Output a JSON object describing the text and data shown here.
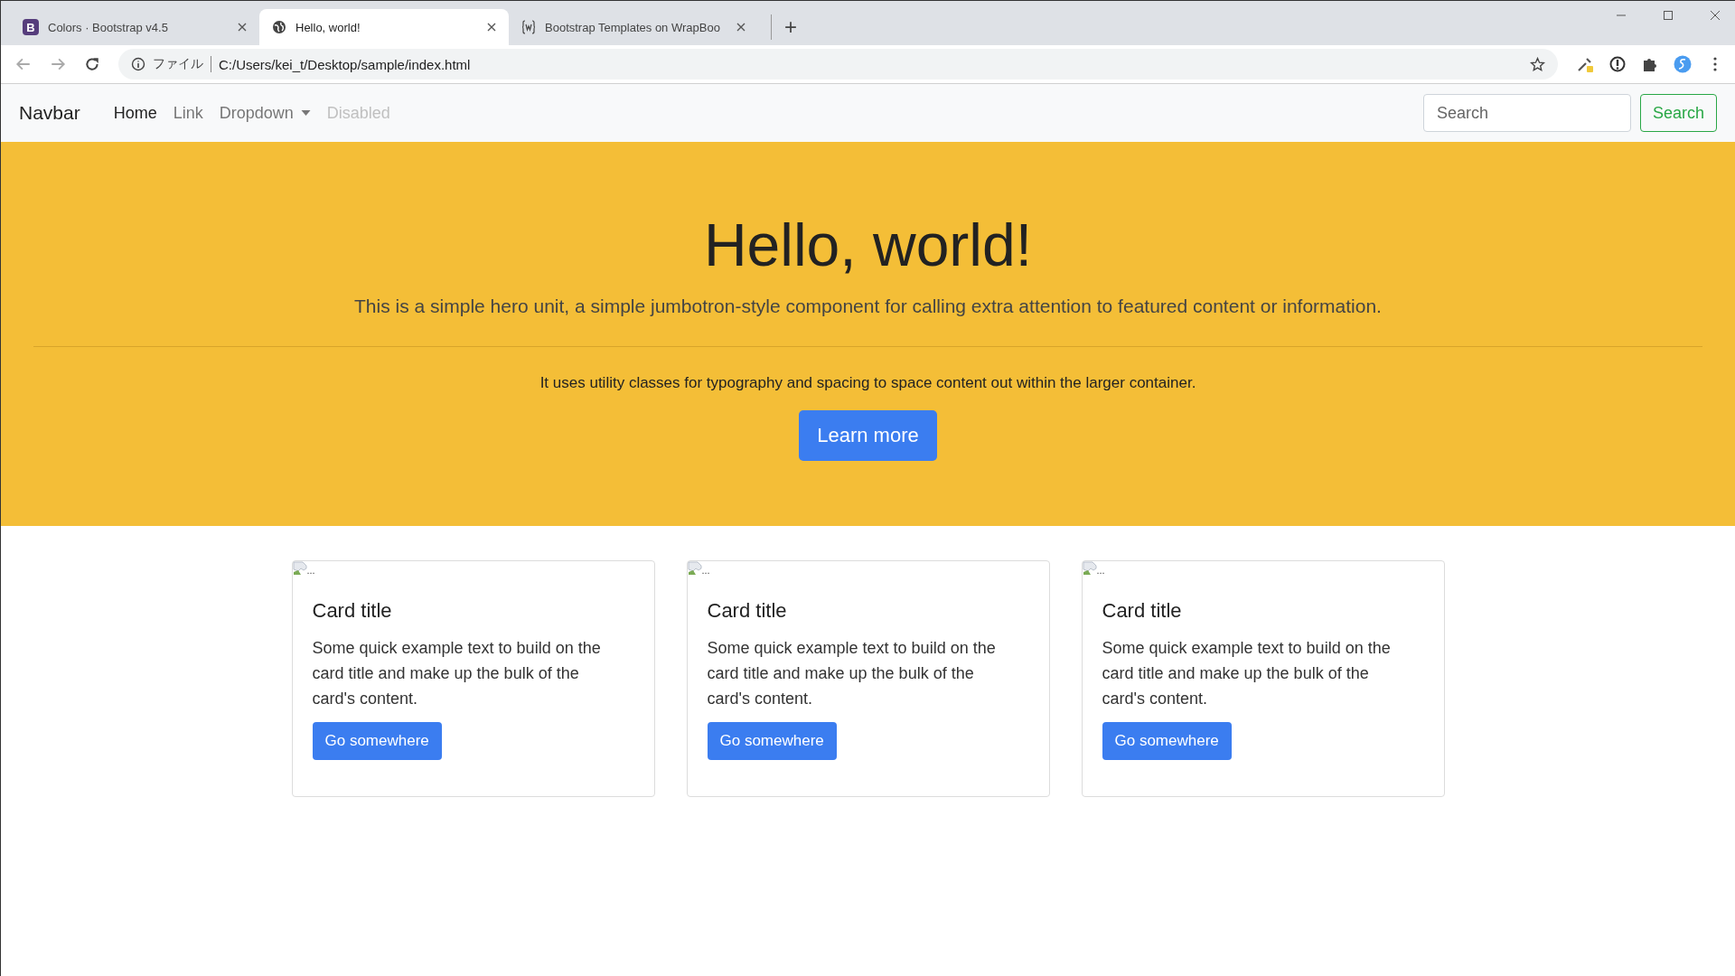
{
  "browser": {
    "tabs": [
      {
        "title": "Colors · Bootstrap v4.5",
        "kind": "letter",
        "favicon_text": "B",
        "selected": false
      },
      {
        "title": "Hello, world!",
        "kind": "globe",
        "selected": true
      },
      {
        "title": "Bootstrap Templates on WrapBoo",
        "kind": "braces",
        "selected": false
      }
    ],
    "new_tab": "+",
    "address": {
      "scheme_label": "ファイル",
      "url": "C:/Users/kei_t/Desktop/sample/index.html"
    }
  },
  "navbar": {
    "brand": "Navbar",
    "items": [
      {
        "label": "Home",
        "selected": true,
        "disabled": false,
        "dropdown": false
      },
      {
        "label": "Link",
        "selected": false,
        "disabled": false,
        "dropdown": false
      },
      {
        "label": "Dropdown",
        "selected": false,
        "disabled": false,
        "dropdown": true
      },
      {
        "label": "Disabled",
        "selected": false,
        "disabled": true,
        "dropdown": false
      }
    ],
    "search": {
      "placeholder": "Search",
      "button": "Search"
    }
  },
  "hero": {
    "title": "Hello, world!",
    "lead": "This is a simple hero unit, a simple jumbotron-style component for calling extra attention to featured content or information.",
    "text": "It uses utility classes for typography and spacing to space content out within the larger container.",
    "button": "Learn more"
  },
  "cards": [
    {
      "image_alt": "...",
      "title": "Card title",
      "text": "Some quick example text to build on the card title and make up the bulk of the card's content.",
      "button": "Go somewhere"
    },
    {
      "image_alt": "...",
      "title": "Card title",
      "text": "Some quick example text to build on the card title and make up the bulk of the card's content.",
      "button": "Go somewhere"
    },
    {
      "image_alt": "...",
      "title": "Card title",
      "text": "Some quick example text to build on the card title and make up the bulk of the card's content.",
      "button": "Go somewhere"
    }
  ]
}
